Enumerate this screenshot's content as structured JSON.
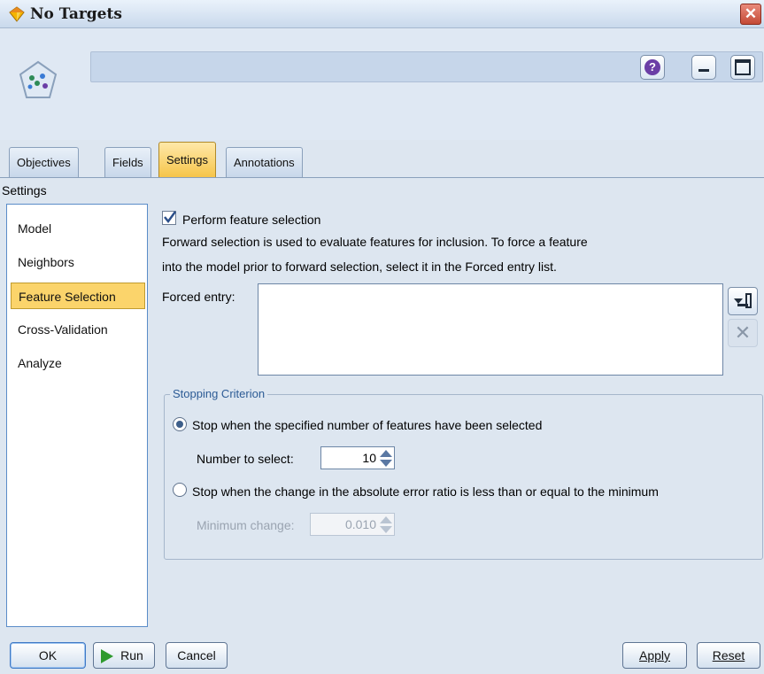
{
  "window": {
    "title": "No Targets",
    "close_glyph": "✕"
  },
  "header": {
    "node_icon": "knn-node-icon",
    "help_glyph": "?"
  },
  "tabs": [
    {
      "label": "Objectives",
      "active": false
    },
    {
      "label": "Fields",
      "active": false
    },
    {
      "label": "Settings",
      "active": true
    },
    {
      "label": "Annotations",
      "active": false
    }
  ],
  "section": {
    "label": "Settings"
  },
  "nav": {
    "items": [
      {
        "label": "Model",
        "active": false
      },
      {
        "label": "Neighbors",
        "active": false
      },
      {
        "label": "Feature Selection",
        "active": true
      },
      {
        "label": "Cross-Validation",
        "active": false
      },
      {
        "label": "Analyze",
        "active": false
      }
    ]
  },
  "feature_selection": {
    "checkbox_label": "Perform feature selection",
    "checked": true,
    "description_line1": "Forward selection is used to evaluate features for inclusion. To force a feature",
    "description_line2": "into the model prior to forward selection, select it in the Forced entry list.",
    "forced_entry_label": "Forced entry:",
    "delete_glyph": "✕"
  },
  "stopping": {
    "group_title": "Stopping Criterion",
    "option1_label": "Stop when the specified number of features have been selected",
    "option1_selected": true,
    "number_label": "Number to select:",
    "number_value": "10",
    "option2_label": "Stop when the change in the absolute error ratio is less than or equal to the minimum",
    "option2_selected": false,
    "min_change_label": "Minimum change:",
    "min_change_value": "0.010"
  },
  "footer": {
    "ok": "OK",
    "run": "Run",
    "cancel": "Cancel",
    "apply": "Apply",
    "reset": "Reset"
  },
  "colors": {
    "active_tab": "#f6c54a",
    "active_nav": "#fbd46b",
    "accent_blue": "#3e5f8a"
  }
}
